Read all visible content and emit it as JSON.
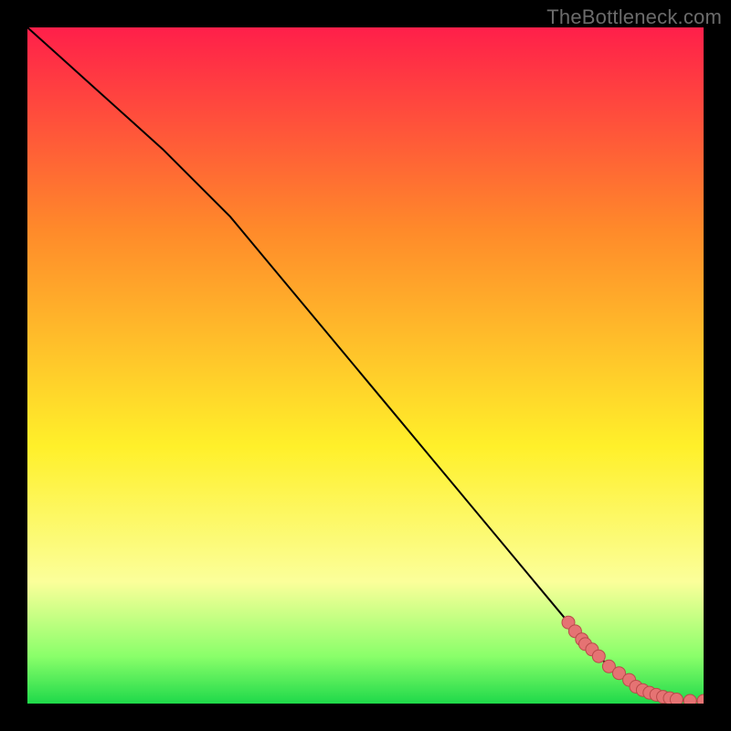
{
  "watermark": "TheBottleneck.com",
  "colors": {
    "grad_top": "#ff1f4a",
    "grad_orange": "#ff8a2a",
    "grad_yellow": "#fff02a",
    "grad_pale": "#fbff9a",
    "grad_green_light": "#8aff6a",
    "grad_green": "#1fd94a",
    "line": "#000000",
    "marker_fill": "#e57373",
    "marker_stroke": "#b94a4a",
    "frame": "#000000"
  },
  "chart_data": {
    "type": "line",
    "title": "",
    "xlabel": "",
    "ylabel": "",
    "xlim": [
      0,
      100
    ],
    "ylim": [
      0,
      100
    ],
    "series": [
      {
        "name": "curve",
        "x": [
          0,
          5,
          10,
          15,
          20,
          25,
          30,
          35,
          40,
          45,
          50,
          55,
          60,
          65,
          70,
          75,
          80,
          82,
          84,
          86,
          88,
          90,
          91,
          92,
          93,
          94,
          95,
          96,
          98,
          100
        ],
        "y": [
          100,
          95.5,
          91,
          86.5,
          82,
          77,
          72,
          66,
          60,
          54,
          48,
          42,
          36,
          30,
          24,
          18,
          12,
          9.5,
          7.5,
          5.5,
          4.0,
          2.5,
          2.0,
          1.6,
          1.3,
          1.0,
          0.8,
          0.6,
          0.4,
          0.4
        ]
      }
    ],
    "markers": {
      "name": "highlighted-points",
      "x": [
        80,
        81,
        82,
        82.5,
        83.5,
        84.5,
        86,
        87.5,
        89,
        90,
        91,
        92,
        93,
        94,
        95,
        96,
        98,
        100
      ],
      "y": [
        12,
        10.7,
        9.5,
        8.8,
        8.0,
        7.0,
        5.5,
        4.5,
        3.5,
        2.5,
        2.0,
        1.6,
        1.3,
        1.0,
        0.8,
        0.6,
        0.4,
        0.4
      ]
    },
    "gradient_stops": [
      {
        "offset": 0.0,
        "key": "grad_top"
      },
      {
        "offset": 0.3,
        "key": "grad_orange"
      },
      {
        "offset": 0.62,
        "key": "grad_yellow"
      },
      {
        "offset": 0.82,
        "key": "grad_pale"
      },
      {
        "offset": 0.93,
        "key": "grad_green_light"
      },
      {
        "offset": 1.0,
        "key": "grad_green"
      }
    ]
  }
}
